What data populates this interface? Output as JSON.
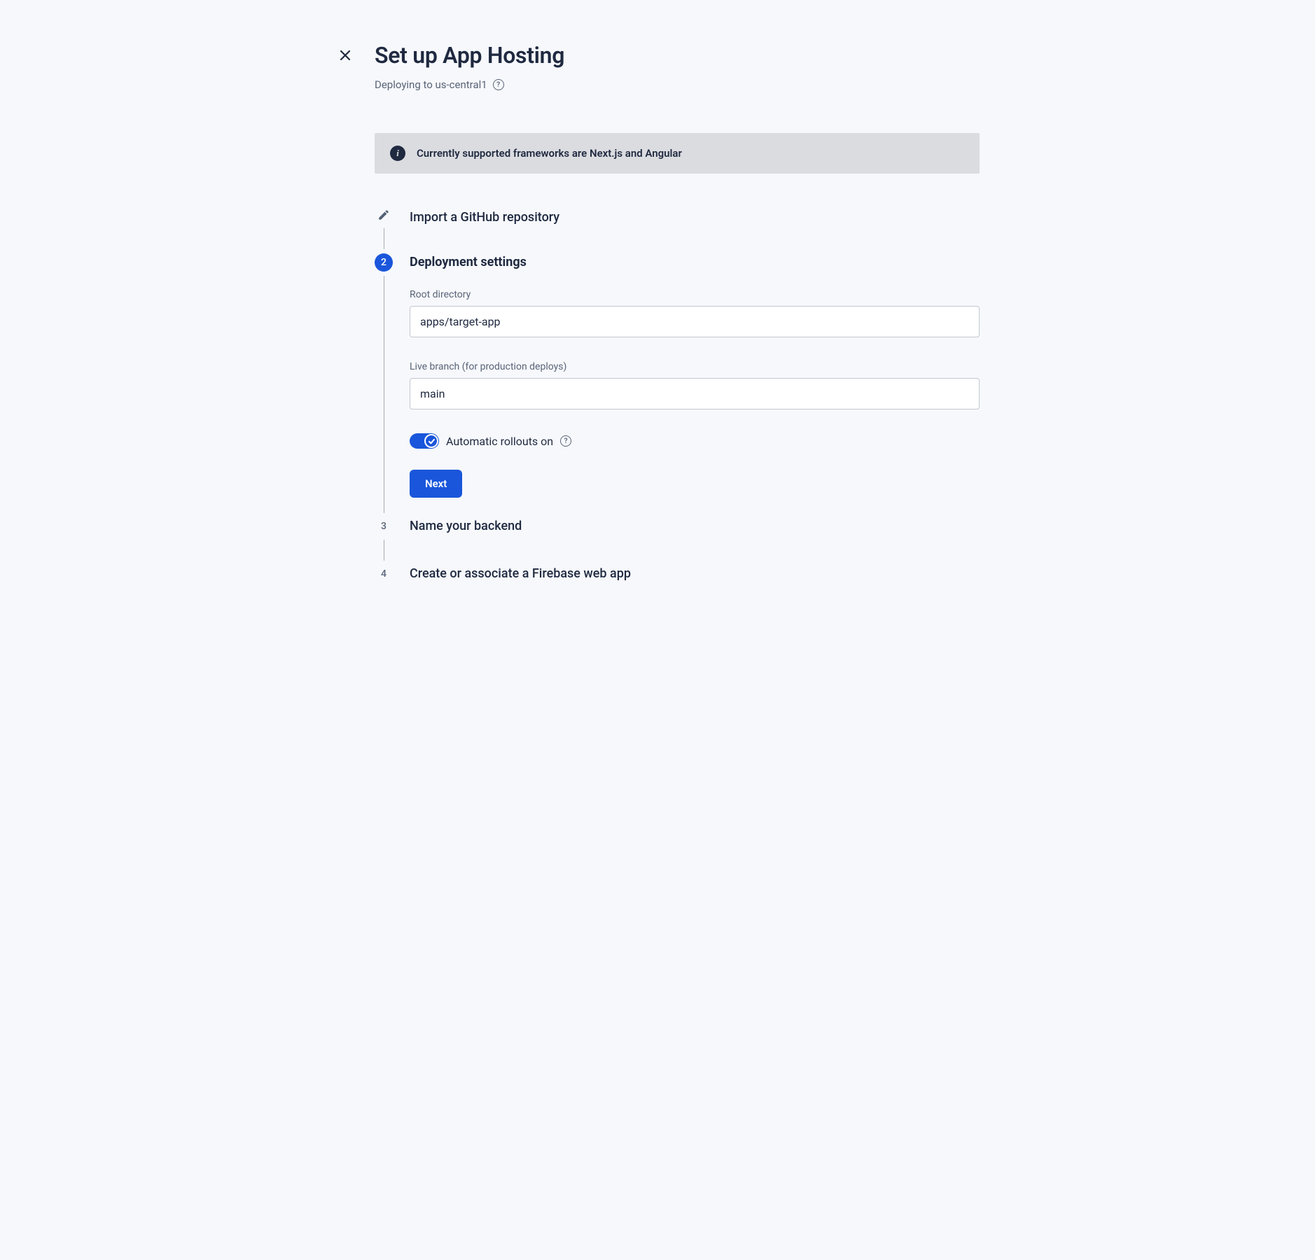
{
  "header": {
    "title": "Set up App Hosting",
    "subtitle": "Deploying to us-central1"
  },
  "banner": {
    "text": "Currently supported frameworks are Next.js and Angular"
  },
  "steps": {
    "step1": {
      "title": "Import a GitHub repository"
    },
    "step2": {
      "number": "2",
      "title": "Deployment settings",
      "rootDir": {
        "label": "Root directory",
        "value": "apps/target-app"
      },
      "liveBranch": {
        "label": "Live branch (for production deploys)",
        "value": "main"
      },
      "rollouts": {
        "label": "Automatic rollouts on"
      },
      "nextLabel": "Next"
    },
    "step3": {
      "number": "3",
      "title": "Name your backend"
    },
    "step4": {
      "number": "4",
      "title": "Create or associate a Firebase web app"
    }
  }
}
